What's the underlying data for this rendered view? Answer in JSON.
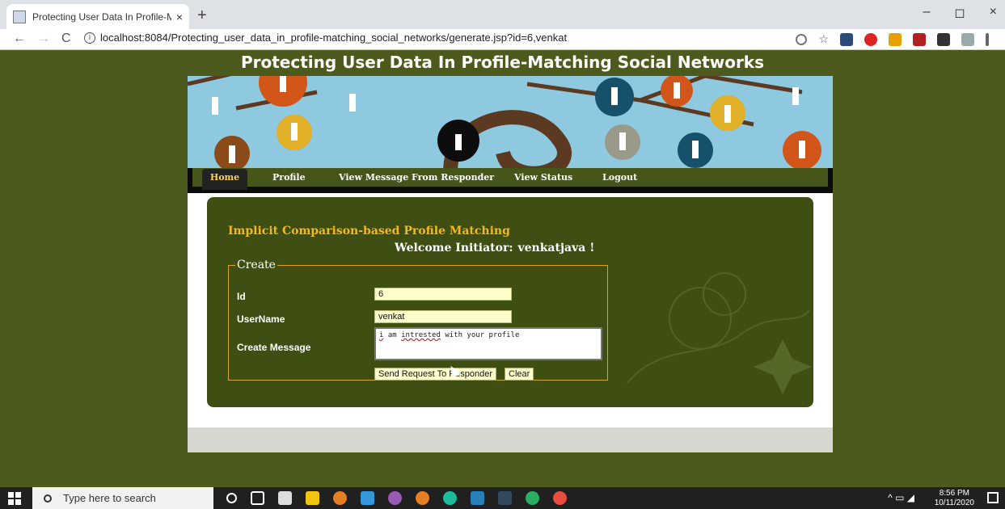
{
  "browser": {
    "tab_title": "Protecting User Data In Profile-M",
    "tab_close": "×",
    "new_tab": "+",
    "url": "localhost:8084/Protecting_user_data_in_profile-matching_social_networks/generate.jsp?id=6,venkat",
    "back": "←",
    "forward": "→",
    "reload": "C",
    "minimize": "–",
    "maximize": "◻",
    "close": "×"
  },
  "site": {
    "title": "Protecting User Data In Profile-Matching Social Networks"
  },
  "nav": {
    "items": [
      "Home",
      "Profile",
      "View Message From Responder",
      "View Status",
      "Logout"
    ]
  },
  "main": {
    "heading": "Implicit Comparison-based Profile Matching",
    "welcome_prefix": "Welcome Initiator:",
    "welcome_user": "venkatjava !",
    "legend": "Create",
    "labels": {
      "id": "Id",
      "username": "UserName",
      "message": "Create Message"
    },
    "values": {
      "id": "6",
      "username": "venkat",
      "message_word1": "i",
      "message_word2": "am",
      "message_word3": "intrested",
      "message_rest": "with your profile"
    },
    "buttons": {
      "send": "Send Request To Responder",
      "clear": "Clear"
    }
  },
  "taskbar": {
    "search_placeholder": "Type here to search",
    "time": "8:56 PM",
    "date": "10/11/2020"
  },
  "colors": {
    "background": "#4d5a1e",
    "nav_bar": "#46561b",
    "card": "#3f4f14",
    "heading": "#f5b71e",
    "input_bg": "#ffffcc"
  }
}
